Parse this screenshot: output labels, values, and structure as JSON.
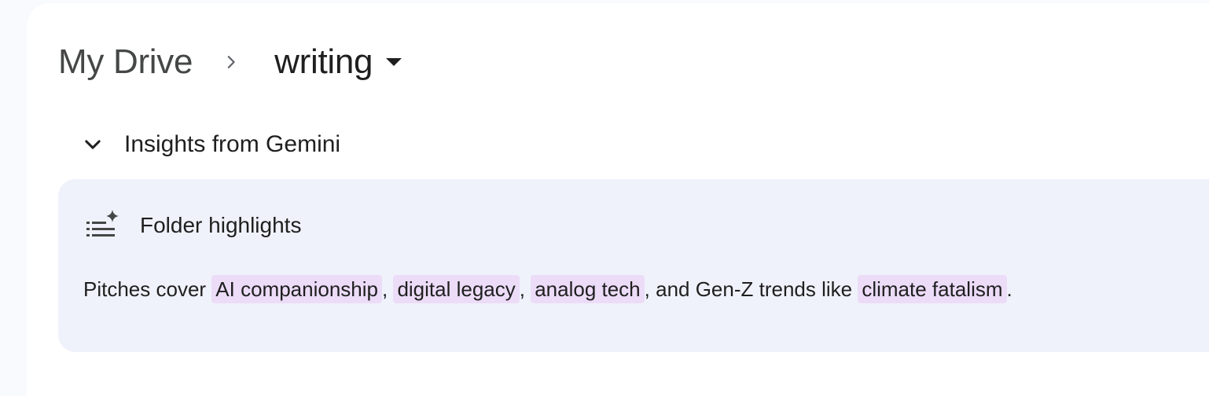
{
  "breadcrumb": {
    "root_label": "My Drive",
    "separator_icon": "chevron-right-icon",
    "current_label": "writing",
    "current_dropdown_icon": "caret-down-icon"
  },
  "insights": {
    "toggle_icon": "chevron-down-icon",
    "title": "Insights from Gemini",
    "card": {
      "icon": "list-sparkle-icon",
      "title": "Folder highlights",
      "summary": {
        "prefix": "Pitches cover ",
        "chip_1": "AI companionship",
        "sep_1": ", ",
        "chip_2": "digital legacy",
        "sep_2": ", ",
        "chip_3": "analog tech",
        "mid": ", and Gen-Z trends like ",
        "chip_4": "climate fatalism",
        "suffix": "."
      }
    }
  },
  "colors": {
    "page_background": "#f8fafd",
    "panel_background": "#ffffff",
    "card_background": "#eff2fa",
    "chip_highlight": "#ecdcf8",
    "text_primary": "#1f1f1f",
    "text_secondary": "#444746"
  }
}
